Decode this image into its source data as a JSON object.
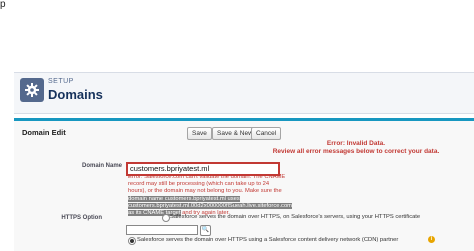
{
  "top_glyph": "p",
  "header": {
    "section": "SETUP",
    "title": "Domains",
    "icon": "gear-icon"
  },
  "edit": {
    "title": "Domain Edit",
    "buttons": {
      "save": "Save",
      "save_new": "Save & New",
      "cancel": "Cancel"
    },
    "error_heading_1": "Error: Invalid Data.",
    "error_heading_2": "Review all error messages below to correct your data."
  },
  "domain_name": {
    "label": "Domain Name",
    "value": "customers.bpriyatest.ml",
    "error_part1": "Error: Salesforce.com can't validate the domain. The CNAME record may still be processing (which can take up to 24 hours), or the domain may not belong to you. Make sure the ",
    "error_hl1": "domain name customers.bpriyatest.ml uses customers.bpriyatest.ml.00d2x000000flSueah.live.siteforce.com as its CNAME target",
    "error_part2": " and try again later."
  },
  "https": {
    "label": "HTTPS Option",
    "option1": "Salesforce serves the domain over HTTPS, on Salesforce's servers, using your HTTPS certificate",
    "option2": "Salesforce serves the domain over HTTPS using a Salesforce content delivery network (CDN) partner"
  },
  "colors": {
    "accent": "#1797c0",
    "error": "#c23934",
    "title": "#16325c"
  }
}
